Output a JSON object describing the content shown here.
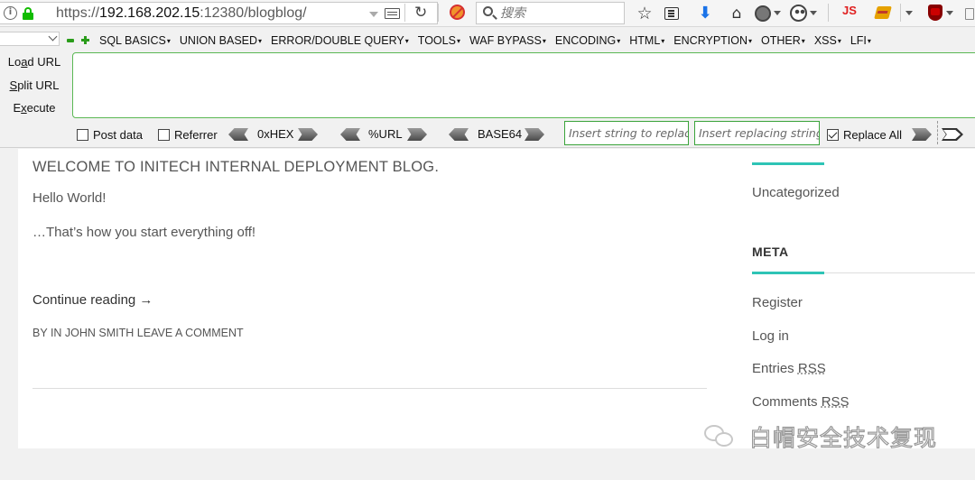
{
  "browser": {
    "url_prefix": "https://",
    "url_host": "192.168.202.15",
    "url_rest": ":12380/blogblog/",
    "search_placeholder": "搜索",
    "js_label": "JS"
  },
  "hackbar": {
    "menu": [
      "SQL BASICS",
      "UNION BASED",
      "ERROR/DOUBLE QUERY",
      "TOOLS",
      "WAF BYPASS",
      "ENCODING",
      "HTML",
      "ENCRYPTION",
      "OTHER",
      "XSS",
      "LFI"
    ],
    "load_url": {
      "pre": "Lo",
      "key": "a",
      "post": "d URL"
    },
    "split_url": {
      "pre": "",
      "key": "S",
      "post": "plit URL"
    },
    "execute": {
      "pre": "E",
      "key": "x",
      "post": "ecute"
    },
    "post_data": "Post data",
    "referrer": "Referrer",
    "hex": "0xHEX",
    "url_enc": "%URL",
    "base64": "BASE64",
    "replace_placeholder": "Insert string to replace",
    "replacing_placeholder": "Insert replacing string",
    "replace_all": "Replace All",
    "post_data_checked": false,
    "referrer_checked": false,
    "replace_all_checked": true
  },
  "post": {
    "title": "WELCOME TO INITECH INTERNAL DEPLOYMENT BLOG.",
    "p1": "Hello World!",
    "p2": "…That’s how you start everything off!",
    "continue": "Continue reading →",
    "meta_by": "BY",
    "meta_in": "IN",
    "meta_author": "JOHN SMITH",
    "meta_comment": "LEAVE A COMMENT"
  },
  "sidebar": {
    "category": "Uncategorized",
    "meta_heading": "META",
    "register": "Register",
    "login": "Log in",
    "entries_pre": "Entries",
    "comments_pre": "Comments",
    "rss": "RSS"
  },
  "watermark": "白帽安全技术复现",
  "colors": {
    "accent": "#2ec4b6",
    "hackbar_green": "#3aa33a",
    "lock_green": "#12bc00"
  }
}
